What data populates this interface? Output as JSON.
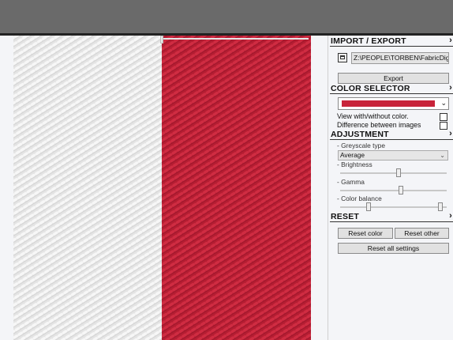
{
  "colors": {
    "fabric_white": "#e9e9e9",
    "fabric_red": "#c8243a",
    "swatch": "#c8243a"
  },
  "import_export": {
    "title": "IMPORT / EXPORT",
    "path_value": "Z:\\PEOPLE\\TORBEN\\FabricDigi",
    "export_label": "Export",
    "folder_icon": "folder-icon"
  },
  "color_selector": {
    "title": "COLOR SELECTOR",
    "selected_color": "#c8243a",
    "view_with_without_label": "View with/without color.",
    "view_with_without_checked": false,
    "difference_label": "Difference between images",
    "difference_checked": false
  },
  "adjustment": {
    "title": "ADJUSTMENT",
    "greyscale_label": "- Greyscale type",
    "greyscale_value": "Average",
    "brightness_label": "- Brightness",
    "brightness_level": 0.55,
    "gamma_label": "- Gamma",
    "gamma_level": 0.57,
    "color_balance_label": "- Color balance",
    "color_balance_low": 0.27,
    "color_balance_high": 0.94
  },
  "reset": {
    "title": "RESET",
    "reset_color_label": "Reset color",
    "reset_other_label": "Reset other",
    "reset_all_label": "Reset all settings"
  },
  "icons": {
    "expand": "chevron-right-icon",
    "dropdown": "chevron-down-icon"
  }
}
